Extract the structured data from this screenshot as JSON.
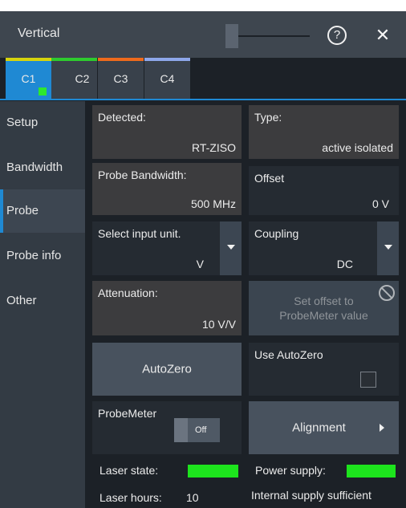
{
  "dialog": {
    "title": "Vertical"
  },
  "tabs": [
    {
      "label": "C1",
      "color": "#d7d40c",
      "active": true
    },
    {
      "label": "C2",
      "color": "#2ecb2e"
    },
    {
      "label": "C3",
      "color": "#ee6a1c"
    },
    {
      "label": "C4",
      "color": "#8ea7ea"
    }
  ],
  "sidebar": {
    "items": [
      {
        "label": "Setup"
      },
      {
        "label": "Bandwidth"
      },
      {
        "label": "Probe",
        "active": true
      },
      {
        "label": "Probe info"
      },
      {
        "label": "Other"
      }
    ]
  },
  "fields": {
    "detected": {
      "label": "Detected:",
      "value": "RT-ZISO"
    },
    "type": {
      "label": "Type:",
      "value": "active isolated"
    },
    "probe_bandwidth": {
      "label": "Probe Bandwidth:",
      "value": "500 MHz"
    },
    "offset": {
      "label": "Offset",
      "value": "0 V"
    },
    "input_unit": {
      "label": "Select input unit.",
      "value": "V"
    },
    "coupling": {
      "label": "Coupling",
      "value": "DC"
    },
    "attenuation": {
      "label": "Attenuation:",
      "value": "10 V/V"
    },
    "set_offset": {
      "label": "Set offset to ProbeMeter value"
    },
    "autozero": {
      "label": "AutoZero"
    },
    "use_autozero": {
      "label": "Use AutoZero"
    },
    "probemeter": {
      "label": "ProbeMeter",
      "state": "Off"
    },
    "alignment": {
      "label": "Alignment"
    }
  },
  "status": {
    "laser_state_label": "Laser state:",
    "power_supply_label": "Power supply:",
    "laser_hours_label": "Laser hours:",
    "laser_hours_value": "10",
    "internal_supply": "Internal supply sufficient",
    "indicator_color": "#1de41d"
  },
  "colors": {
    "accent": "#1f89d3",
    "panel": "#1c2127"
  }
}
